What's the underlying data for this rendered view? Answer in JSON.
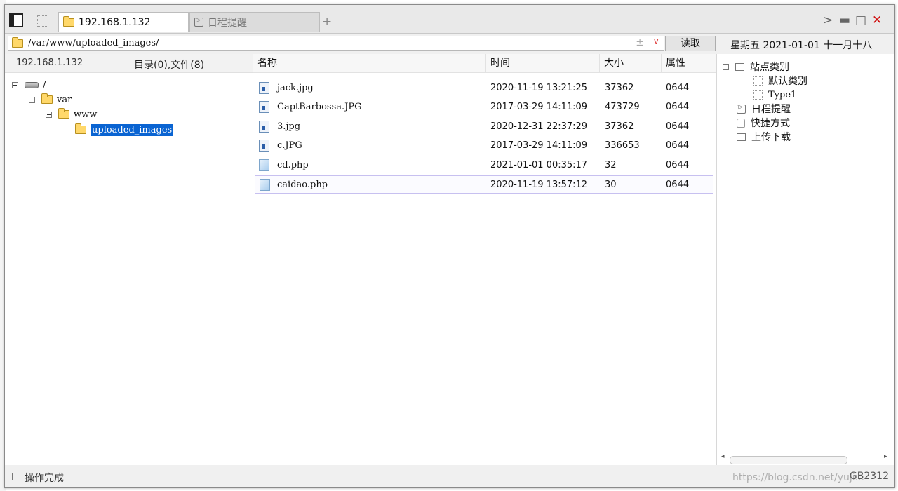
{
  "tabs": [
    {
      "label": "192.168.1.132",
      "active": true,
      "icon": "folder-icon"
    },
    {
      "label": "日程提醒",
      "active": false,
      "icon": "schedule-icon"
    }
  ],
  "address": {
    "path": "/var/www/uploaded_images/",
    "plusminus": "±",
    "dropdown": "∨"
  },
  "read_button": "读取",
  "date": "星期五  2021-01-01  十一月十八",
  "left": {
    "host": "192.168.1.132",
    "count": "目录(0),文件(8)",
    "tree": [
      "/",
      "var",
      "www",
      "uploaded_images"
    ]
  },
  "columns": [
    "名称",
    "时间",
    "大小",
    "属性"
  ],
  "files": [
    {
      "name": "jack.jpg",
      "time": "2020-11-19 13:21:25",
      "size": "37362",
      "attr": "0644",
      "kind": "img"
    },
    {
      "name": "CaptBarbossa.JPG",
      "time": "2017-03-29 14:11:09",
      "size": "473729",
      "attr": "0644",
      "kind": "img"
    },
    {
      "name": "3.jpg",
      "time": "2020-12-31 22:37:29",
      "size": "37362",
      "attr": "0644",
      "kind": "img"
    },
    {
      "name": "c.JPG",
      "time": "2017-03-29 14:11:09",
      "size": "336653",
      "attr": "0644",
      "kind": "img"
    },
    {
      "name": "cd.php",
      "time": "2021-01-01 00:35:17",
      "size": "32",
      "attr": "0644",
      "kind": "php"
    },
    {
      "name": "caidao.php",
      "time": "2020-11-19 13:57:12",
      "size": "30",
      "attr": "0644",
      "kind": "php"
    }
  ],
  "right": {
    "site_category": "站点类别",
    "sub": [
      "默认类别",
      "Type1"
    ],
    "schedule": "日程提醒",
    "shortcut": "快捷方式",
    "transfer": "上传下载"
  },
  "status": "操作完成",
  "encoding": "GB2312",
  "watermark": "https://blog.csdn.net/yuji..."
}
